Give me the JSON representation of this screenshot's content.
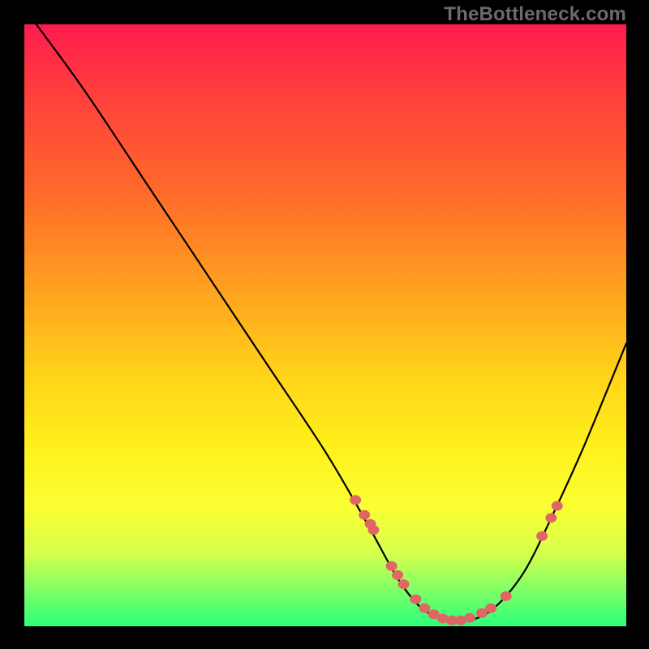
{
  "watermark": "TheBottleneck.com",
  "chart_data": {
    "type": "line",
    "title": "",
    "xlabel": "",
    "ylabel": "",
    "xlim": [
      0,
      100
    ],
    "ylim": [
      0,
      100
    ],
    "grid": false,
    "legend": false,
    "background_gradient": {
      "direction": "vertical",
      "stops": [
        {
          "pos": 0,
          "color": "#ff1a4d"
        },
        {
          "pos": 0.28,
          "color": "#ff6a2a"
        },
        {
          "pos": 0.58,
          "color": "#ffd21a"
        },
        {
          "pos": 0.8,
          "color": "#fbff33"
        },
        {
          "pos": 1.0,
          "color": "#2bff7a"
        }
      ]
    },
    "series": [
      {
        "name": "bottleneck-curve",
        "x": [
          2,
          10,
          20,
          30,
          40,
          50,
          57,
          62,
          66,
          70,
          74,
          78,
          83,
          88,
          93,
          100
        ],
        "y": [
          100,
          89,
          74,
          59,
          44,
          29,
          17,
          8,
          3,
          1,
          1,
          3,
          9,
          19,
          30,
          47
        ]
      }
    ],
    "markers": {
      "name": "highlighted-points",
      "color": "#e06666",
      "x": [
        55,
        56.5,
        57.5,
        58,
        61,
        62,
        63,
        65,
        66.5,
        68,
        69.5,
        71,
        72.5,
        74,
        76,
        77.5,
        80,
        86,
        87.5,
        88.5
      ],
      "y": [
        21,
        18.5,
        17,
        16,
        10,
        8.5,
        7,
        4.5,
        3,
        2,
        1.3,
        1,
        1,
        1.4,
        2.2,
        3,
        5,
        15,
        18,
        20
      ]
    }
  }
}
